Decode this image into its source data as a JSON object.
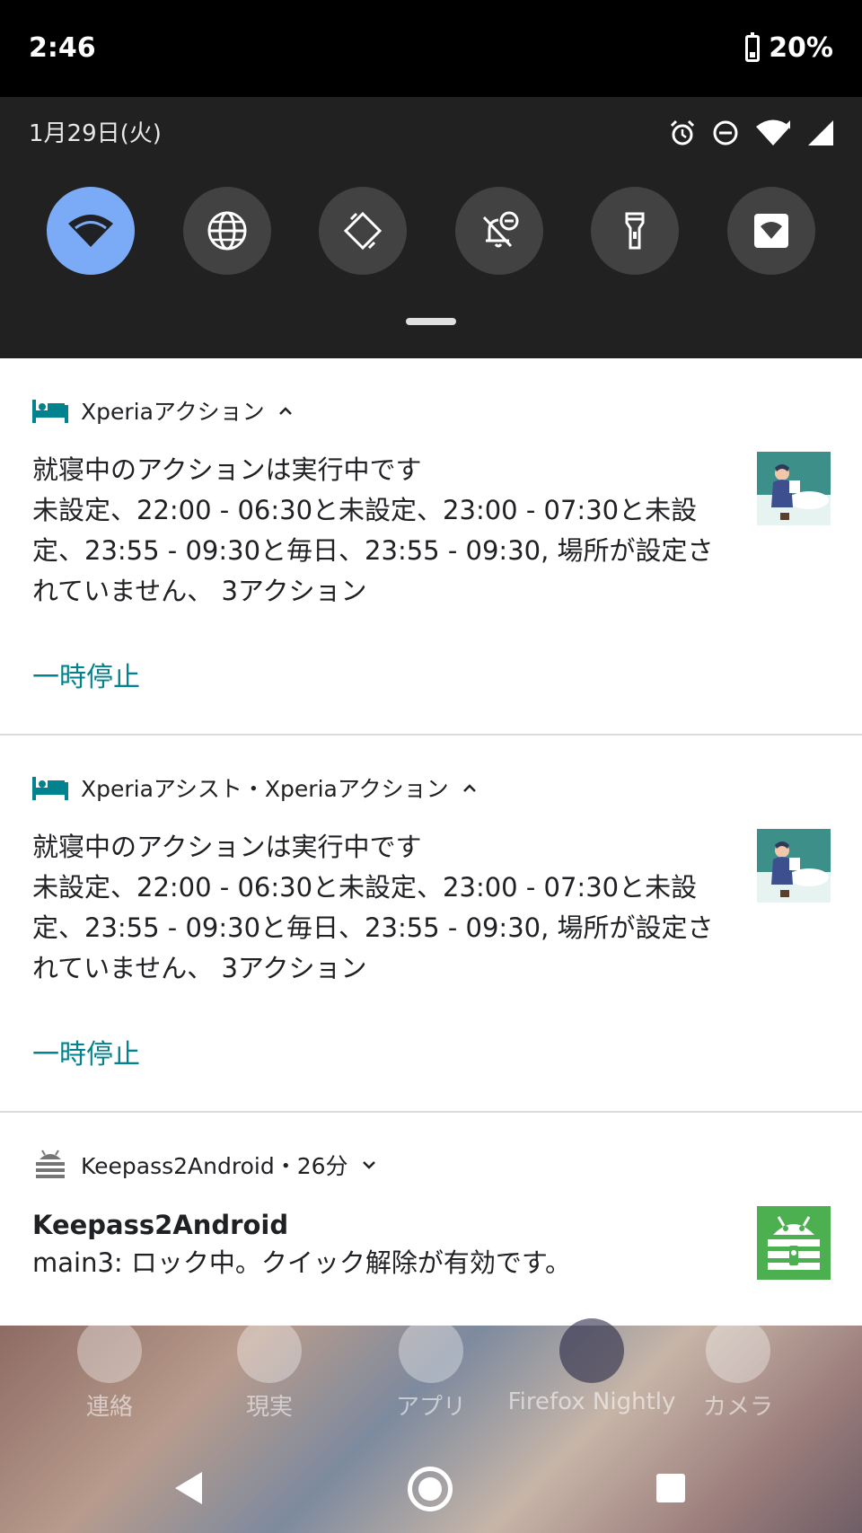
{
  "status_bar": {
    "time": "2:46",
    "battery_percent": "20%"
  },
  "quick_settings": {
    "date": "1月29日(火)",
    "indicators": [
      "alarm-icon",
      "dnd-icon",
      "wifi-icon",
      "signal-icon"
    ],
    "tiles": [
      {
        "name": "wifi",
        "icon": "wifi-icon",
        "active": true
      },
      {
        "name": "globe",
        "icon": "globe-icon",
        "active": false
      },
      {
        "name": "auto-rotate",
        "icon": "rotate-icon",
        "active": false
      },
      {
        "name": "do-not-disturb",
        "icon": "bell-off-icon",
        "active": false
      },
      {
        "name": "flashlight",
        "icon": "flashlight-icon",
        "active": false
      },
      {
        "name": "hotspot",
        "icon": "hotspot-icon",
        "active": false
      }
    ],
    "accent": "#7baaf7"
  },
  "notifications": [
    {
      "app": "Xperiaアクション",
      "app_icon": "bed-icon",
      "title": "就寝中のアクションは実行中です",
      "lines": [
        "未設定、22:00 - 06:30と未設定、23:00 - 07:30と未設",
        "定、23:55 - 09:30と毎日、23:55 - 09:30, 場所が設定さ",
        "れていません、 3アクション"
      ],
      "action": "一時停止"
    },
    {
      "app": "Xperiaアシスト・Xperiaアクション",
      "app_icon": "bed-icon",
      "title": "就寝中のアクションは実行中です",
      "lines": [
        "未設定、22:00 - 06:30と未設定、23:00 - 07:30と未設",
        "定、23:55 - 09:30と毎日、23:55 - 09:30, 場所が設定さ",
        "れていません、 3アクション"
      ],
      "action": "一時停止"
    },
    {
      "app": "Keepass2Android・26分",
      "app_icon": "keepass-icon",
      "title": "Keepass2Android",
      "text": "main3: ロック中。クイック解除が有効です。"
    }
  ],
  "dock": {
    "items": [
      "連絡",
      "現実",
      "アプリ",
      "Firefox Nightly",
      "カメラ"
    ]
  },
  "colors": {
    "action_teal": "#00838f",
    "keepass_green": "#4caf50"
  }
}
